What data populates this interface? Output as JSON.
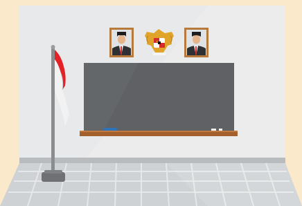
{
  "scene": {
    "description_items": [
      "classroom-wall",
      "chalkboard",
      "two-framed-portraits",
      "national-emblem",
      "red-white-flag",
      "tiled-floor"
    ]
  },
  "colors": {
    "background": "#fbe9cc",
    "wall": "#e6e7e8",
    "board": "#5f6165",
    "ledge": "#a35f2c",
    "floor": "#c9ccce",
    "flag_red": "#e42127",
    "flag_white": "#f2f2f2",
    "pole": "#8a8c90",
    "chalk_blue": "#2f74b8",
    "emblem_gold": "#e1a42b"
  }
}
